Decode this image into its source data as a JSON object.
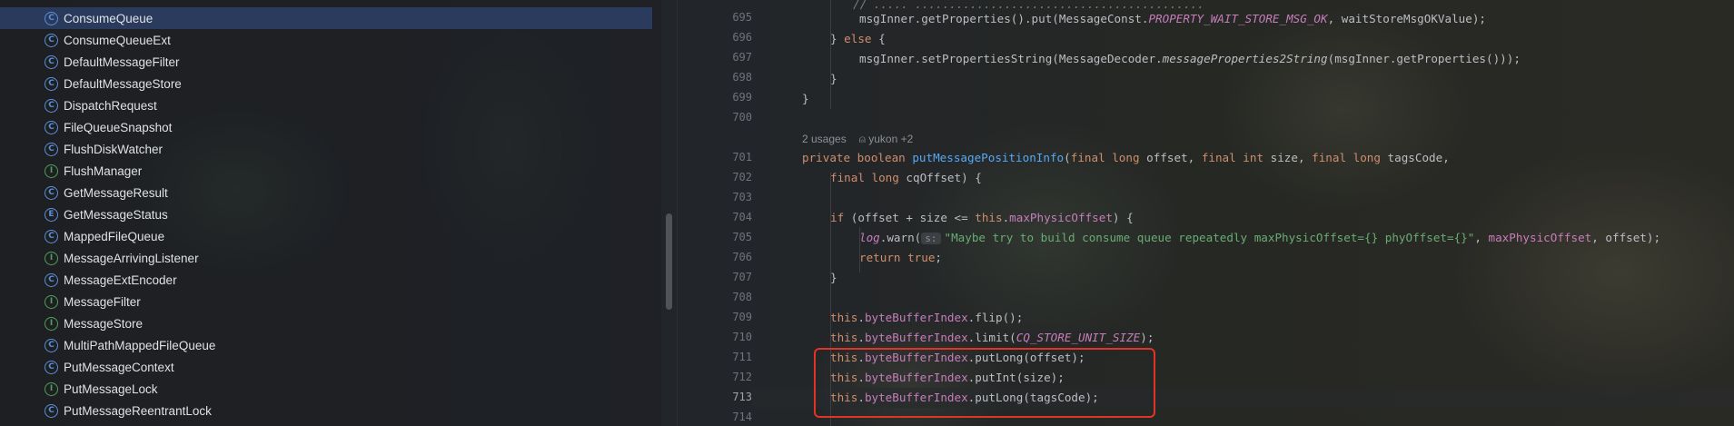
{
  "project_tree": {
    "items": [
      {
        "label": "ConsumeQueue",
        "kind": "C",
        "selected": true
      },
      {
        "label": "ConsumeQueueExt",
        "kind": "C"
      },
      {
        "label": "DefaultMessageFilter",
        "kind": "C"
      },
      {
        "label": "DefaultMessageStore",
        "kind": "C"
      },
      {
        "label": "DispatchRequest",
        "kind": "C"
      },
      {
        "label": "FileQueueSnapshot",
        "kind": "C"
      },
      {
        "label": "FlushDiskWatcher",
        "kind": "C"
      },
      {
        "label": "FlushManager",
        "kind": "I"
      },
      {
        "label": "GetMessageResult",
        "kind": "C"
      },
      {
        "label": "GetMessageStatus",
        "kind": "E"
      },
      {
        "label": "MappedFileQueue",
        "kind": "C"
      },
      {
        "label": "MessageArrivingListener",
        "kind": "I"
      },
      {
        "label": "MessageExtEncoder",
        "kind": "C"
      },
      {
        "label": "MessageFilter",
        "kind": "I"
      },
      {
        "label": "MessageStore",
        "kind": "I"
      },
      {
        "label": "MultiPathMappedFileQueue",
        "kind": "C"
      },
      {
        "label": "PutMessageContext",
        "kind": "C"
      },
      {
        "label": "PutMessageLock",
        "kind": "I"
      },
      {
        "label": "PutMessageReentrantLock",
        "kind": "C"
      }
    ]
  },
  "editor": {
    "line_numbers": [
      "695",
      "696",
      "697",
      "698",
      "699",
      "700",
      "701",
      "702",
      "703",
      "704",
      "705",
      "706",
      "707",
      "708",
      "709",
      "710",
      "711",
      "712",
      "713",
      "714"
    ],
    "current_line": "713",
    "usages_label": "2 usages",
    "author_label": "yukon +2",
    "code": {
      "l695_a": "msgInner.getProperties().put(MessageConst.",
      "l695_b": "PROPERTY_WAIT_STORE_MSG_OK",
      "l695_c": ", waitStoreMsgOKValue);",
      "l696_a": "} ",
      "l696_b": "else",
      "l696_c": " {",
      "l697_a": "msgInner.setPropertiesString(MessageDecoder.",
      "l697_b": "messageProperties2String",
      "l697_c": "(msgInner.getProperties()));",
      "l698": "}",
      "l699": "}",
      "l701_kw1": "private boolean ",
      "l701_method": "putMessagePositionInfo",
      "l701_p1": "(",
      "l701_kw2": "final long ",
      "l701_p2": "offset, ",
      "l701_kw3": "final int ",
      "l701_p3": "size, ",
      "l701_kw4": "final long ",
      "l701_p4": "tagsCode,",
      "l702_kw": "final long ",
      "l702_rest": "cqOffset) {",
      "l704_kw": "if",
      "l704_a": " (offset + size <= ",
      "l704_this": "this",
      "l704_dot": ".",
      "l704_field": "maxPhysicOffset",
      "l704_b": ") {",
      "l705_log": "log",
      "l705_a": ".warn(",
      "l705_hint": "s:",
      "l705_str": "\"Maybe try to build consume queue repeatedly maxPhysicOffset={} phyOffset={}\"",
      "l705_b": ", ",
      "l705_field": "maxPhysicOffset",
      "l705_c": ", offset);",
      "l706_kw": "return true",
      "l706_end": ";",
      "l707": "}",
      "this_kw": "this",
      "dot": ".",
      "bbi": "byteBufferIndex",
      "l709_rest": ".flip();",
      "l710_a": ".limit(",
      "l710_const": "CQ_STORE_UNIT_SIZE",
      "l710_b": ");",
      "l711_rest": ".putLong(offset);",
      "l712_rest": ".putInt(size);",
      "l713_rest": ".putLong(tagsCode);"
    }
  },
  "colors": {
    "keyword": "#cf8e6d",
    "field": "#c77dbb",
    "method": "#56a8f5",
    "string": "#6aab73",
    "selection": "#2e436e",
    "highlight_box": "#e03526"
  }
}
